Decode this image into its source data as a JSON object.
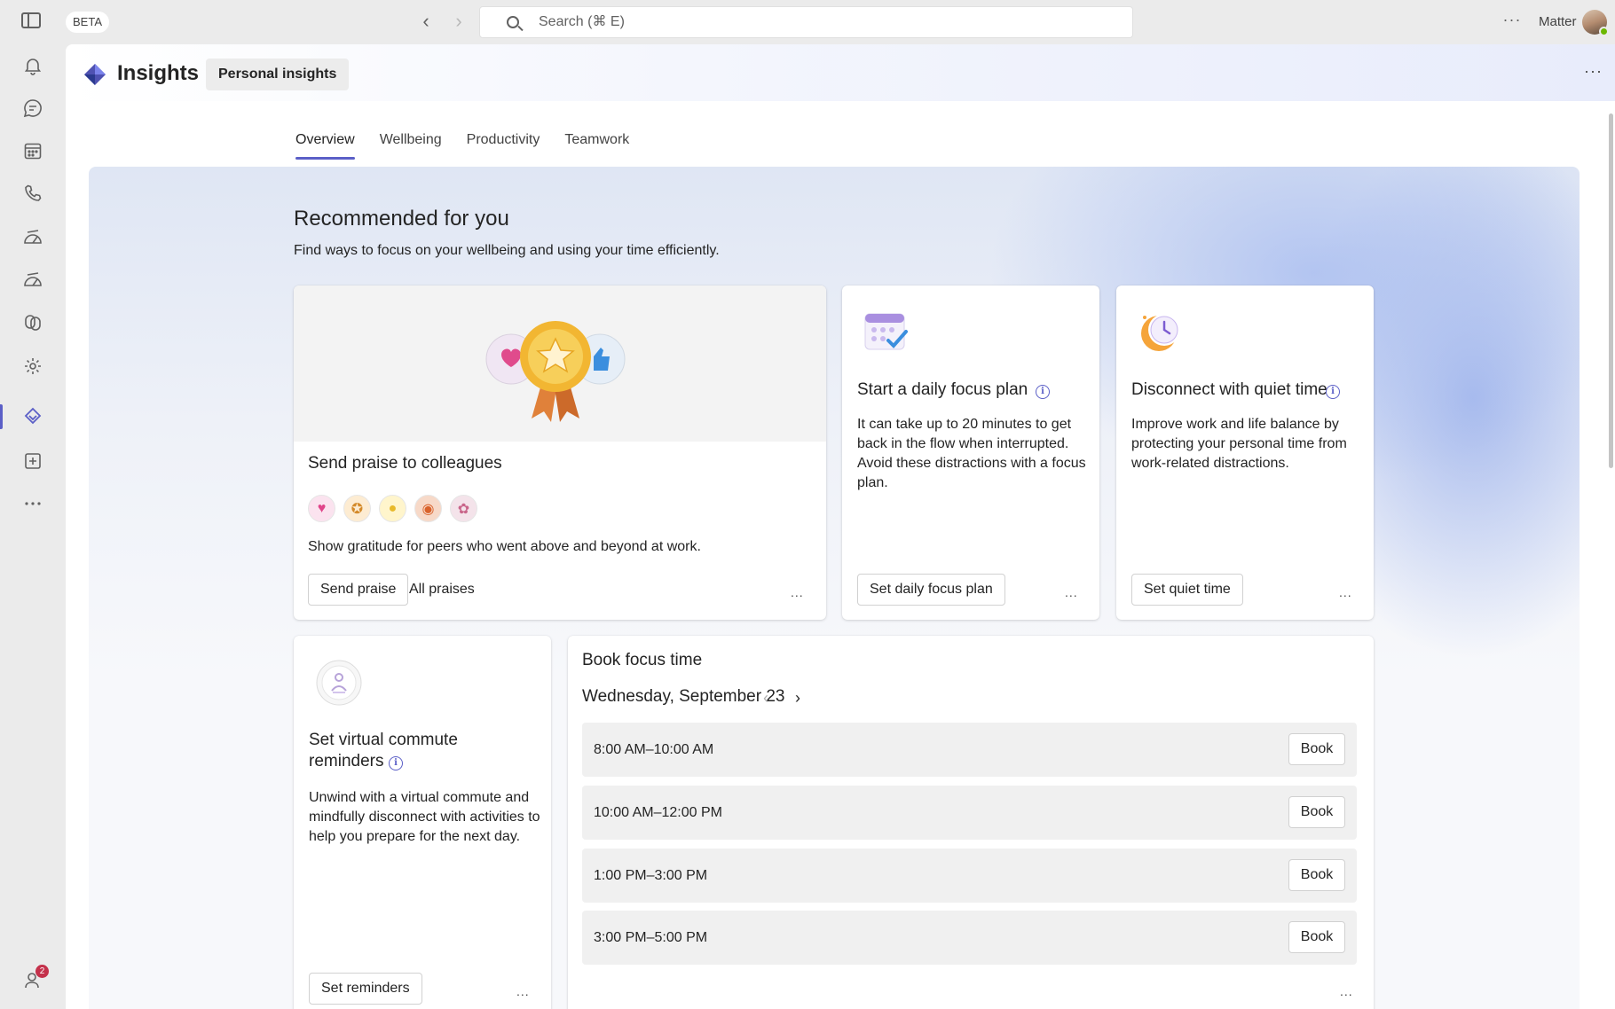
{
  "titlebar": {
    "beta_label": "BETA",
    "search_placeholder": "Search (⌘ E)",
    "org_name": "Matter"
  },
  "rail": {
    "items": [
      {
        "icon": "bell-icon",
        "name": "activity"
      },
      {
        "icon": "chat-icon",
        "name": "chat"
      },
      {
        "icon": "calendar-icon",
        "name": "calendar"
      },
      {
        "icon": "phone-icon",
        "name": "calls"
      },
      {
        "icon": "gauge-icon",
        "name": "app-1"
      },
      {
        "icon": "gauge-icon",
        "name": "app-2"
      },
      {
        "icon": "loop-icon",
        "name": "app-3"
      },
      {
        "icon": "gear-app-icon",
        "name": "app-4"
      },
      {
        "icon": "insights-icon",
        "name": "insights",
        "active": true
      },
      {
        "icon": "add-app-icon",
        "name": "add-apps"
      },
      {
        "icon": "more-icon",
        "name": "more-apps"
      }
    ],
    "people_badge_count": "2"
  },
  "app": {
    "title": "Insights",
    "tab_label": "Personal insights"
  },
  "subtabs": [
    {
      "label": "Overview",
      "active": true
    },
    {
      "label": "Wellbeing"
    },
    {
      "label": "Productivity"
    },
    {
      "label": "Teamwork"
    }
  ],
  "hero": {
    "title": "Recommended for you",
    "subtitle": "Find ways to focus on your wellbeing and using your time efficiently."
  },
  "cards": {
    "praise": {
      "title": "Send praise to colleagues",
      "badges": [
        "heart-badge-icon",
        "medal-badge-icon",
        "lightbulb-badge-icon",
        "basketball-badge-icon",
        "palette-badge-icon"
      ],
      "body": "Show gratitude for peers who went above and beyond at work.",
      "primary_button": "Send praise",
      "secondary_button": "All praises",
      "more": "..."
    },
    "focus_plan": {
      "title": "Start a daily focus plan",
      "body": "It can take up to 20 minutes to get back in the flow when interrupted. Avoid these distractions with a focus plan.",
      "button": "Set daily focus plan",
      "more": "..."
    },
    "quiet_time": {
      "title": "Disconnect with quiet time",
      "body": "Improve work and life balance by protecting your personal time from work-related distractions.",
      "button": "Set quiet time",
      "more": "..."
    },
    "commute": {
      "title_line1": "Set virtual commute",
      "title_line2": "reminders",
      "body": "Unwind with a virtual commute and mindfully disconnect with activities to help you prepare for the next day.",
      "button": "Set reminders",
      "more": "..."
    },
    "book_focus": {
      "title": "Book focus time",
      "date": "Wednesday, September 23",
      "slots": [
        {
          "time": "8:00 AM–10:00 AM",
          "button": "Book"
        },
        {
          "time": "10:00 AM–12:00 PM",
          "button": "Book"
        },
        {
          "time": "1:00 PM–3:00 PM",
          "button": "Book"
        },
        {
          "time": "3:00 PM–5:00 PM",
          "button": "Book"
        }
      ],
      "more": "..."
    }
  },
  "colors": {
    "accent": "#5b5fc7",
    "badge_red": "#c4314b",
    "presence_green": "#6bb700"
  }
}
